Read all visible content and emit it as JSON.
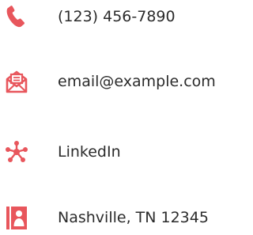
{
  "accent_color": "#e8565c",
  "contacts": [
    {
      "icon": "phone-icon",
      "label": "(123) 456-7890"
    },
    {
      "icon": "envelope-icon",
      "label": "email@example.com"
    },
    {
      "icon": "network-icon",
      "label": "LinkedIn"
    },
    {
      "icon": "address-card-icon",
      "label": "Nashville, TN 12345"
    }
  ]
}
